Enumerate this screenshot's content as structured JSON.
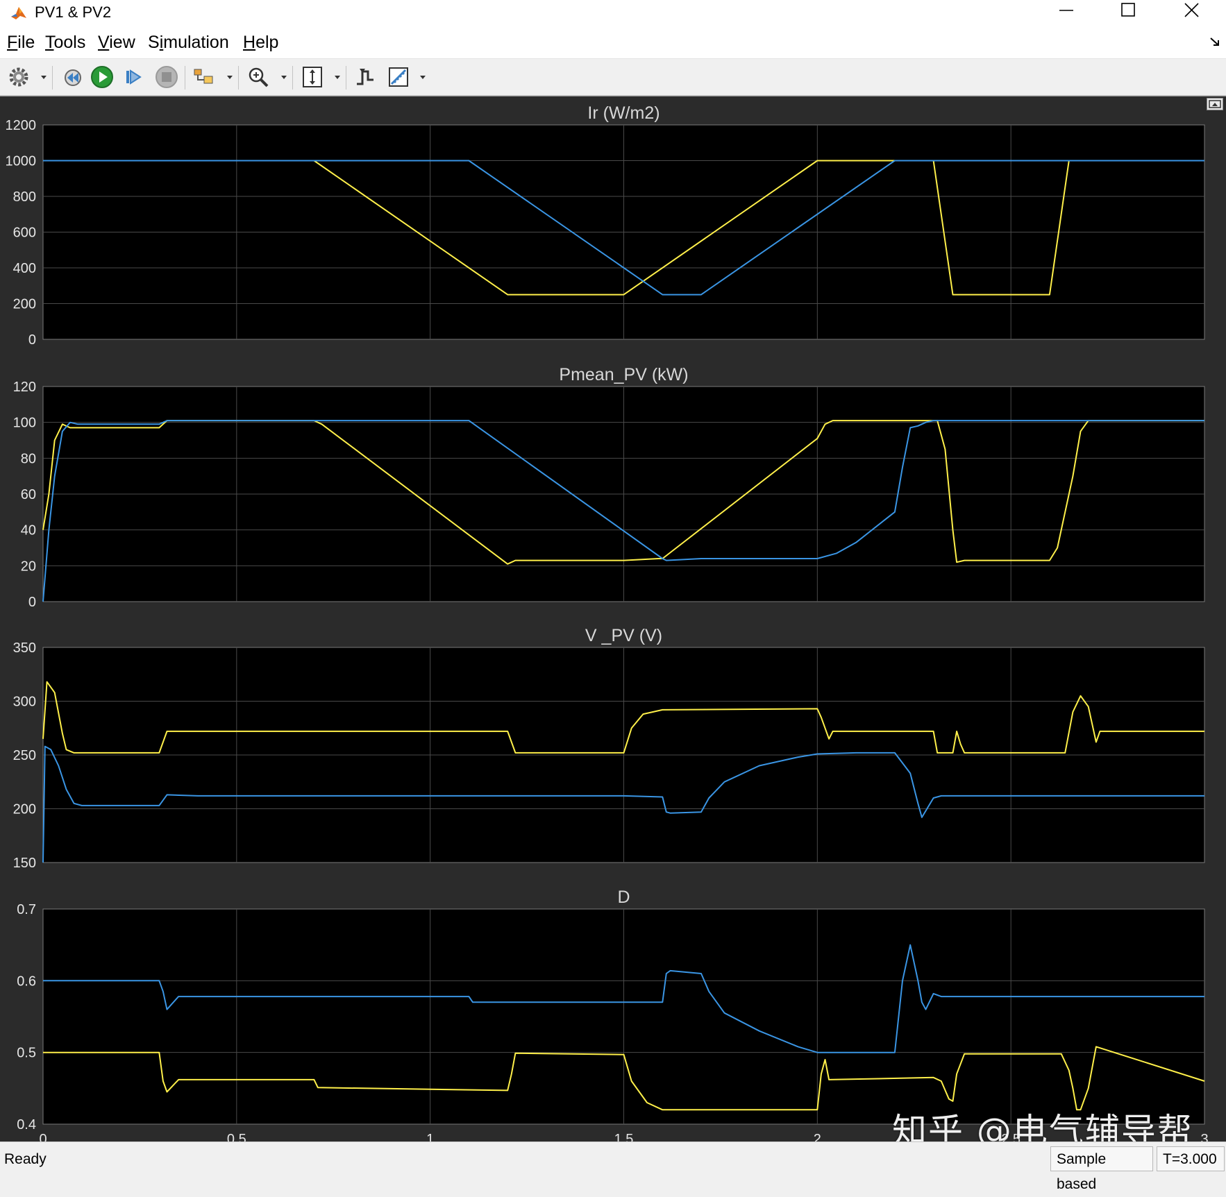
{
  "window": {
    "title": "PV1 & PV2",
    "icon": "matlab-logo-icon"
  },
  "menu": [
    {
      "pre": "",
      "u": "F",
      "post": "ile"
    },
    {
      "pre": "",
      "u": "T",
      "post": "ools"
    },
    {
      "pre": "",
      "u": "V",
      "post": "iew"
    },
    {
      "pre": "S",
      "u": "i",
      "post": "mulation"
    },
    {
      "pre": "",
      "u": "H",
      "post": "elp"
    }
  ],
  "toolbar": {
    "icons": [
      "gear-icon",
      "step-back-icon",
      "run-icon",
      "step-forward-icon",
      "stop-icon",
      "highlight-icon",
      "zoom-icon",
      "autoscale-icon",
      "triggers-icon",
      "cursor-measure-icon"
    ]
  },
  "colors": {
    "series1": "#fff04a",
    "series2": "#3a95e4",
    "axes_bg": "#000000",
    "figure_bg": "#2b2b2b",
    "grid": "#4a4a4a",
    "text": "#e6e6e6"
  },
  "chart_data": [
    {
      "type": "line",
      "title": "Ir (W/m2)",
      "xlim": [
        0,
        3
      ],
      "ylim": [
        0,
        1200
      ],
      "yticks": [
        "0",
        "200",
        "400",
        "600",
        "800",
        "1000",
        "1200"
      ],
      "xticks": [],
      "grid": true,
      "series": [
        {
          "color": "yellow",
          "x": [
            0,
            0.7,
            1.2,
            1.5,
            2.0,
            2.2,
            2.3,
            2.35,
            2.6,
            2.65,
            3.0
          ],
          "y": [
            1000,
            1000,
            250,
            250,
            1000,
            1000,
            1000,
            250,
            250,
            1000,
            1000
          ]
        },
        {
          "color": "blue",
          "x": [
            0,
            1.1,
            1.6,
            1.7,
            2.2,
            3.0
          ],
          "y": [
            1000,
            1000,
            250,
            250,
            1000,
            1000
          ]
        }
      ]
    },
    {
      "type": "line",
      "title": "Pmean_PV (kW)",
      "xlim": [
        0,
        3
      ],
      "ylim": [
        0,
        120
      ],
      "yticks": [
        "0",
        "20",
        "40",
        "60",
        "80",
        "100",
        "120"
      ],
      "xticks": [],
      "grid": true,
      "series": [
        {
          "color": "yellow",
          "x": [
            0,
            0.015,
            0.03,
            0.05,
            0.07,
            0.09,
            0.3,
            0.32,
            0.7,
            0.72,
            1.2,
            1.22,
            1.5,
            1.59,
            1.6,
            2.0,
            2.02,
            2.04,
            2.3,
            2.31,
            2.33,
            2.35,
            2.36,
            2.38,
            2.6,
            2.62,
            2.66,
            2.68,
            2.7,
            3.0
          ],
          "y": [
            40,
            60,
            90,
            99,
            97,
            97,
            97,
            101,
            101,
            99,
            21,
            23,
            23,
            24,
            24,
            91,
            99,
            101,
            101,
            101,
            85,
            40,
            22,
            23,
            23,
            30,
            70,
            95,
            101,
            101
          ]
        },
        {
          "color": "blue",
          "x": [
            0,
            0.015,
            0.03,
            0.05,
            0.07,
            0.09,
            0.3,
            0.32,
            1.1,
            1.6,
            1.61,
            1.7,
            2.0,
            2.05,
            2.1,
            2.2,
            2.22,
            2.24,
            2.26,
            2.28,
            2.3,
            2.31,
            3.0
          ],
          "y": [
            0,
            40,
            70,
            95,
            100,
            99,
            99,
            101,
            101,
            24,
            23,
            24,
            24,
            27,
            33,
            50,
            75,
            97,
            98,
            100,
            101,
            101,
            101
          ]
        }
      ]
    },
    {
      "type": "line",
      "title": "V _PV (V)",
      "xlim": [
        0,
        3
      ],
      "ylim": [
        150,
        350
      ],
      "yticks": [
        "150",
        "200",
        "250",
        "300",
        "350"
      ],
      "xticks": [],
      "grid": true,
      "series": [
        {
          "color": "yellow",
          "x": [
            0,
            0.01,
            0.03,
            0.05,
            0.06,
            0.08,
            0.3,
            0.32,
            1.2,
            1.22,
            1.5,
            1.52,
            1.55,
            1.6,
            2.0,
            2.01,
            2.03,
            2.04,
            2.3,
            2.31,
            2.35,
            2.36,
            2.37,
            2.38,
            2.39,
            2.64,
            2.66,
            2.68,
            2.7,
            2.72,
            2.73,
            3.0
          ],
          "y": [
            265,
            318,
            308,
            270,
            255,
            252,
            252,
            272,
            272,
            252,
            252,
            275,
            288,
            292,
            293,
            285,
            265,
            272,
            272,
            252,
            252,
            272,
            260,
            252,
            252,
            252,
            290,
            305,
            295,
            262,
            272,
            272
          ]
        },
        {
          "color": "blue",
          "x": [
            0,
            0.005,
            0.02,
            0.04,
            0.06,
            0.08,
            0.1,
            0.3,
            0.32,
            0.4,
            1.5,
            1.6,
            1.61,
            1.62,
            1.7,
            1.72,
            1.76,
            1.85,
            1.95,
            2.0,
            2.1,
            2.2,
            2.24,
            2.26,
            2.27,
            2.3,
            2.32,
            3.0
          ],
          "y": [
            150,
            258,
            255,
            240,
            218,
            205,
            203,
            203,
            213,
            212,
            212,
            211,
            197,
            196,
            197,
            210,
            225,
            240,
            248,
            251,
            252,
            252,
            233,
            205,
            192,
            210,
            212,
            212
          ]
        }
      ]
    },
    {
      "type": "line",
      "title": "D",
      "xlim": [
        0,
        3
      ],
      "ylim": [
        0.4,
        0.7
      ],
      "yticks": [
        "0.4",
        "0.5",
        "0.6",
        "0.7"
      ],
      "xticks": [
        "0",
        "0.5",
        "1",
        "1.5",
        "2",
        "2.5",
        "3"
      ],
      "grid": true,
      "series": [
        {
          "color": "yellow",
          "x": [
            0,
            0.3,
            0.31,
            0.32,
            0.35,
            0.7,
            0.71,
            1.2,
            1.21,
            1.22,
            1.5,
            1.52,
            1.56,
            1.6,
            2.0,
            2.01,
            2.02,
            2.03,
            2.3,
            2.32,
            2.34,
            2.35,
            2.36,
            2.38,
            2.4,
            2.63,
            2.65,
            2.66,
            2.67,
            2.68,
            2.7,
            2.72,
            3.0
          ],
          "y": [
            0.5,
            0.5,
            0.46,
            0.445,
            0.462,
            0.462,
            0.451,
            0.447,
            0.47,
            0.499,
            0.497,
            0.46,
            0.43,
            0.42,
            0.42,
            0.47,
            0.49,
            0.462,
            0.465,
            0.46,
            0.435,
            0.432,
            0.47,
            0.498,
            0.498,
            0.498,
            0.475,
            0.45,
            0.42,
            0.42,
            0.45,
            0.508,
            0.46
          ]
        },
        {
          "color": "blue",
          "x": [
            0,
            0.3,
            0.31,
            0.32,
            0.35,
            1.1,
            1.11,
            1.6,
            1.61,
            1.62,
            1.7,
            1.72,
            1.76,
            1.85,
            1.95,
            2.0,
            2.2,
            2.22,
            2.24,
            2.26,
            2.27,
            2.28,
            2.3,
            2.32,
            3.0
          ],
          "y": [
            0.6,
            0.6,
            0.585,
            0.56,
            0.578,
            0.578,
            0.57,
            0.57,
            0.61,
            0.614,
            0.61,
            0.585,
            0.555,
            0.53,
            0.508,
            0.5,
            0.5,
            0.6,
            0.65,
            0.6,
            0.57,
            0.56,
            0.582,
            0.578,
            0.578
          ]
        }
      ]
    }
  ],
  "status": {
    "left": "Ready",
    "mode": "Sample based",
    "time": "T=3.000"
  },
  "watermark": "知乎 @电气辅导帮"
}
